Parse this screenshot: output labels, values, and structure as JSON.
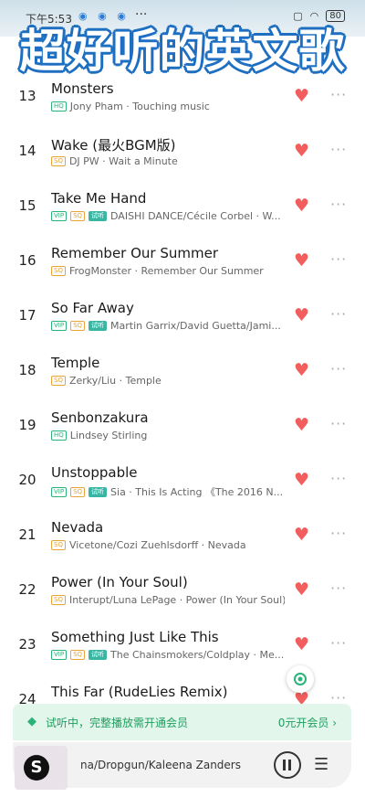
{
  "status_bar": {
    "time": "下午5:53",
    "app_icons": "◉ ◉ ◉",
    "dots": "···",
    "battery": "80"
  },
  "overlay_title": "超好听的英文歌",
  "tracks": [
    {
      "num": "13",
      "title": "Monsters",
      "badges": [
        "HQ"
      ],
      "meta": "Jony Pham · Touching music"
    },
    {
      "num": "14",
      "title": "Wake (最火BGM版)",
      "badges": [
        "SQ"
      ],
      "meta": "DJ PW · Wait a Minute"
    },
    {
      "num": "15",
      "title": "Take Me Hand",
      "badges": [
        "VIP",
        "SQ",
        "试听"
      ],
      "meta": "DAISHI DANCE/Cécile Corbel · W..."
    },
    {
      "num": "16",
      "title": "Remember Our Summer",
      "badges": [
        "SQ"
      ],
      "meta": "FrogMonster · Remember Our Summer"
    },
    {
      "num": "17",
      "title": "So Far Away",
      "badges": [
        "VIP",
        "SQ",
        "试听"
      ],
      "meta": "Martin Garrix/David Guetta/Jami..."
    },
    {
      "num": "18",
      "title": "Temple",
      "badges": [
        "SQ"
      ],
      "meta": "Zerky/Liu · Temple"
    },
    {
      "num": "19",
      "title": "Senbonzakura",
      "badges": [
        "HQ"
      ],
      "meta": "Lindsey Stirling"
    },
    {
      "num": "20",
      "title": "Unstoppable",
      "badges": [
        "VIP",
        "SQ",
        "试听"
      ],
      "meta": "Sia · This Is Acting 《The 2016 N..."
    },
    {
      "num": "21",
      "title": "Nevada",
      "badges": [
        "SQ"
      ],
      "meta": "Vicetone/Cozi Zuehlsdorff · Nevada"
    },
    {
      "num": "22",
      "title": "Power (In Your Soul)",
      "badges": [
        "SQ"
      ],
      "meta": "Interupt/Luna LePage · Power (In Your Soul)"
    },
    {
      "num": "23",
      "title": "Something Just Like This",
      "badges": [
        "VIP",
        "SQ",
        "试听"
      ],
      "meta": "The Chainsmokers/Coldplay · Me..."
    },
    {
      "num": "24",
      "title": "This Far (RudeLies Remix)",
      "badges": [],
      "meta": ""
    }
  ],
  "banner": {
    "text": "试听中，完整播放需开通会员",
    "cta": "0元开会员 ›"
  },
  "player": {
    "now_playing": "na/Dropgun/Kaleena Zanders",
    "cover_letter": "S"
  },
  "colors": {
    "heart": "#f25d5d",
    "accent_green": "#1d9f5e",
    "title_stroke": "#1e6fc1"
  }
}
